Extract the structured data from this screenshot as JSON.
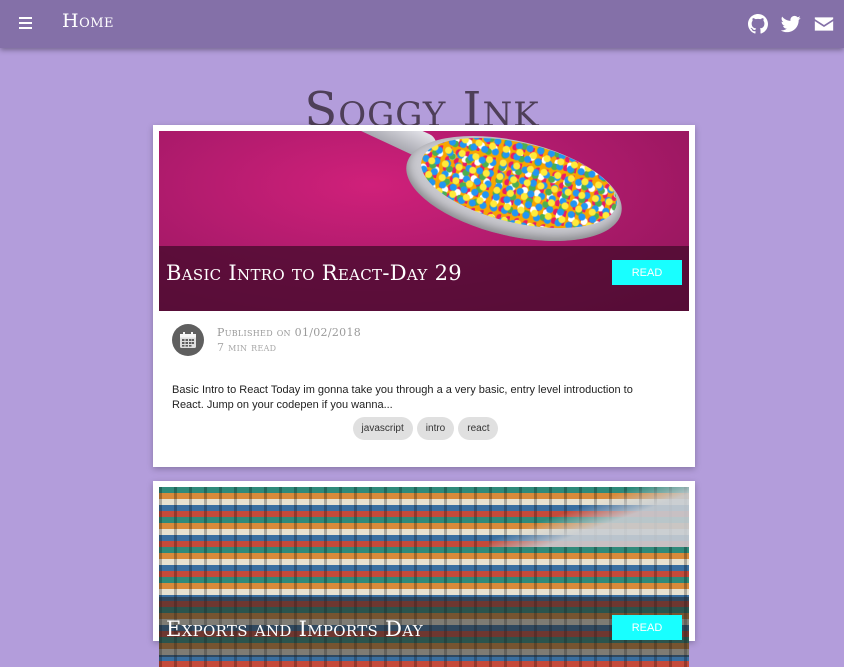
{
  "nav": {
    "title": "Home",
    "icons": [
      "github-icon",
      "twitter-icon",
      "email-icon"
    ]
  },
  "site": {
    "title": "Soggy Ink"
  },
  "posts": [
    {
      "title": "Basic Intro to React-Day 29",
      "read_label": "READ",
      "published": "Published on 01/02/2018",
      "read_time": "7 min read",
      "excerpt": "Basic Intro to React Today im gonna take you through a a very basic, entry level introduction to React. Jump on your codepen if you wanna...",
      "tags": [
        "javascript",
        "intro",
        "react"
      ]
    },
    {
      "title": "Exports and Imports Day",
      "read_label": "READ"
    }
  ],
  "colors": {
    "background": "#b39ddb",
    "topbar": "#8470a8",
    "accent": "#18ffff",
    "title_text": "#4e3f58"
  }
}
